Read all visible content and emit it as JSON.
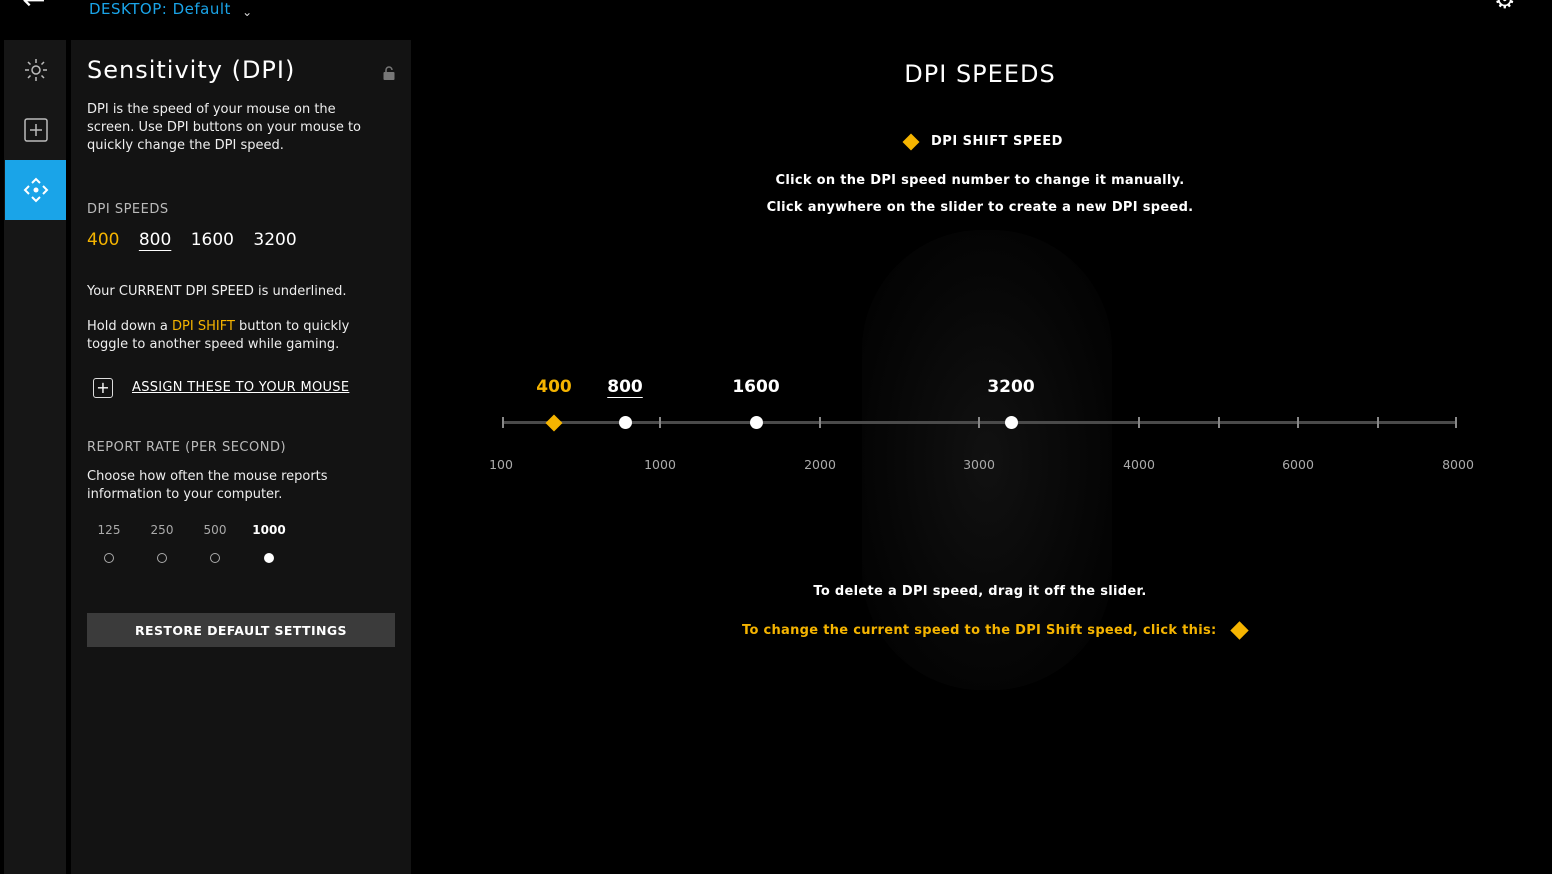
{
  "topbar": {
    "profile_prefix": "DESKTOP:",
    "profile_name": "Default"
  },
  "rail": [
    "lighting-icon",
    "add-icon",
    "dpi-icon"
  ],
  "panel": {
    "title": "Sensitivity (DPI)",
    "description": "DPI is the speed of your mouse on the screen. Use DPI buttons on your mouse to quickly change the DPI speed.",
    "dpi_speeds_heading": "DPI SPEEDS",
    "dpi_speeds": [
      "400",
      "800",
      "1600",
      "3200"
    ],
    "current_note": "Your CURRENT DPI SPEED is underlined.",
    "shift_note_pre": "Hold down a ",
    "shift_note_highlight": "DPI SHIFT",
    "shift_note_post": " button to quickly toggle to another speed while gaming.",
    "assign_label": "ASSIGN THESE TO YOUR MOUSE",
    "report_rate_heading": "REPORT RATE (PER SECOND)",
    "report_rate_desc": "Choose how often the mouse reports information to your computer.",
    "report_rates": [
      "125",
      "250",
      "500",
      "1000"
    ],
    "report_rate_selected": "1000",
    "restore_label": "RESTORE DEFAULT SETTINGS"
  },
  "main": {
    "title": "DPI SPEEDS",
    "legend_label": "DPI SHIFT SPEED",
    "instruction_1": "Click on the DPI speed number to change it manually.",
    "instruction_2": "Click anywhere on the slider to create a new DPI speed.",
    "slider_axis": [
      "100",
      "1000",
      "2000",
      "3000",
      "4000",
      "6000",
      "8000"
    ],
    "slider_values": [
      "400",
      "800",
      "1600",
      "3200"
    ],
    "delete_note": "To delete a DPI speed, drag it off the slider.",
    "shift_change_note": "To change the current speed to the DPI Shift speed, click this:"
  },
  "colors": {
    "accent": "#1aa4e8",
    "shift": "#f5b400"
  }
}
